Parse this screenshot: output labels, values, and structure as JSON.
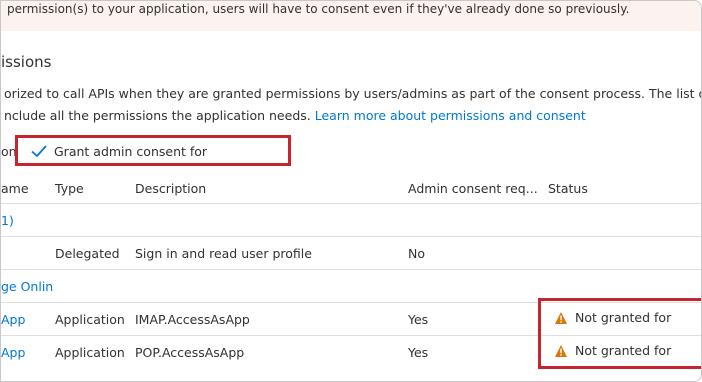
{
  "banner": {
    "text": "permission(s) to your application, users will have to consent even if they've already done so previously."
  },
  "section": {
    "title": "issions",
    "description_line1": "orized to call APIs when they are granted permissions by users/admins as part of the consent process. The list of configured",
    "description_line2_prefix": "nclude all the permissions the application needs.",
    "learn_more_link": "Learn more about permissions and consent"
  },
  "toolbar": {
    "lead_text": "on",
    "grant_button_label": "Grant admin consent for"
  },
  "table": {
    "headers": [
      "ame",
      "Type",
      "Description",
      "Admin consent req...",
      "Status"
    ],
    "group1": {
      "label": "1)"
    },
    "row1": {
      "name": "",
      "type": "Delegated",
      "description": "Sign in and read user profile",
      "admin": "No",
      "status": ""
    },
    "group2": {
      "label": "ge Onlin"
    },
    "row2": {
      "name": "App",
      "type": "Application",
      "description": "IMAP.AccessAsApp",
      "admin": "Yes",
      "status": "Not granted for"
    },
    "row3": {
      "name": "App",
      "type": "Application",
      "description": "POP.AccessAsApp",
      "admin": "Yes",
      "status": "Not granted for"
    }
  },
  "colors": {
    "accent": "#0078d4",
    "highlight": "#c7252d",
    "warning": "#d97706"
  },
  "icons": {
    "check": "check-icon",
    "warning": "warning-icon"
  }
}
